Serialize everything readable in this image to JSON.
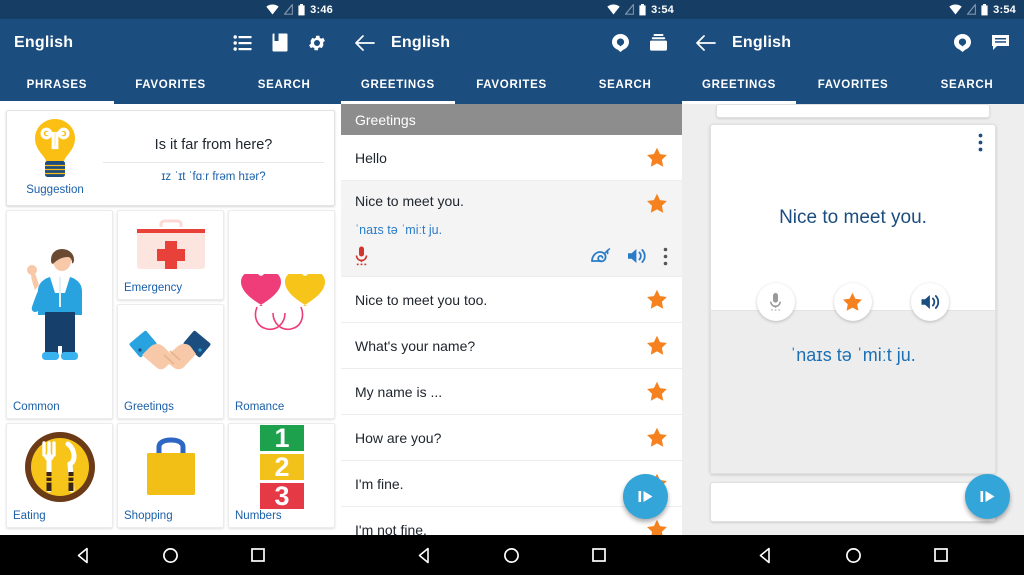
{
  "statusbar": {
    "time_left": "3:46",
    "time_mid": "3:54",
    "time_right": "3:54",
    "wifi_icon": "wifi-icon",
    "signal_icon": "signal-off-icon",
    "battery_icon": "battery-icon"
  },
  "panel1": {
    "title": "English",
    "actions": [
      {
        "name": "phrasebook-list-icon",
        "label": "list"
      },
      {
        "name": "flashcards-icon",
        "label": "flashcards"
      },
      {
        "name": "gear-icon",
        "label": "settings"
      }
    ],
    "tabs": [
      {
        "label": "PHRASES",
        "active": true
      },
      {
        "label": "FAVORITES",
        "active": false
      },
      {
        "label": "SEARCH",
        "active": false
      }
    ],
    "suggestion": {
      "caption": "Suggestion",
      "phrase": "Is it far from here?",
      "ipa": "ɪz ˈɪt ˈfɑːr frəm hɪər?"
    },
    "tiles": [
      {
        "label": "Common",
        "icon": "person-pointing-icon"
      },
      {
        "label": "Emergency",
        "icon": "first-aid-kit-icon"
      },
      {
        "label": "Romance",
        "icon": "two-hearts-icon"
      },
      {
        "label": "Greetings",
        "icon": "handshake-icon"
      },
      {
        "label": "Eating",
        "icon": "fork-knife-plate-icon"
      },
      {
        "label": "Shopping",
        "icon": "shopping-bag-icon"
      },
      {
        "label": "Numbers",
        "icon": "numbers-123-icon"
      }
    ]
  },
  "panel2": {
    "title": "English",
    "back_icon": "back-arrow-icon",
    "actions": [
      {
        "name": "quiz-balloon-icon",
        "label": "quiz"
      },
      {
        "name": "stacked-cards-icon",
        "label": "cards"
      }
    ],
    "tabs": [
      {
        "label": "GREETINGS",
        "active": true
      },
      {
        "label": "FAVORITES",
        "active": false
      },
      {
        "label": "SEARCH",
        "active": false
      }
    ],
    "section_header": "Greetings",
    "phrases": [
      {
        "text": "Hello",
        "favorite": true,
        "expanded": false
      },
      {
        "text": "Nice to meet you.",
        "ipa": "ˈnaɪs tə ˈmiːt ju.",
        "favorite": true,
        "expanded": true,
        "row_actions": [
          "mic-record-icon",
          "snail-slow-speech-icon",
          "speaker-icon",
          "overflow-menu-icon"
        ]
      },
      {
        "text": "Nice to meet you too.",
        "favorite": true,
        "expanded": false
      },
      {
        "text": "What's your name?",
        "favorite": true,
        "expanded": false
      },
      {
        "text": "My name is ...",
        "favorite": true,
        "expanded": false
      },
      {
        "text": "How are you?",
        "favorite": true,
        "expanded": false
      },
      {
        "text": "I'm fine.",
        "favorite": true,
        "expanded": false
      },
      {
        "text": "I'm not fine.",
        "favorite": true,
        "expanded": false
      }
    ],
    "fab": {
      "name": "play-all-fab",
      "icon": "play-icon"
    }
  },
  "panel3": {
    "title": "English",
    "back_icon": "back-arrow-icon",
    "actions": [
      {
        "name": "quiz-balloon-icon",
        "label": "quiz"
      },
      {
        "name": "chat-bubble-icon",
        "label": "conversation"
      }
    ],
    "tabs": [
      {
        "label": "GREETINGS",
        "active": true
      },
      {
        "label": "FAVORITES",
        "active": false
      },
      {
        "label": "SEARCH",
        "active": false
      }
    ],
    "card": {
      "menu_icon": "overflow-menu-icon",
      "front": "Nice to meet you.",
      "back_ipa": "ˈnaɪs tə ˈmiːt ju.",
      "buttons": [
        {
          "name": "mic-record-button",
          "icon": "mic-icon"
        },
        {
          "name": "favorite-button",
          "icon": "star-icon"
        },
        {
          "name": "speak-button",
          "icon": "speaker-icon"
        }
      ]
    },
    "fab": {
      "name": "play-all-fab",
      "icon": "play-icon"
    }
  },
  "navbar": [
    {
      "name": "nav-back-button",
      "icon": "triangle-back-icon"
    },
    {
      "name": "nav-home-button",
      "icon": "circle-home-icon"
    },
    {
      "name": "nav-recents-button",
      "icon": "square-recents-icon"
    }
  ],
  "colors": {
    "appbar": "#1b4d7e",
    "statusbar": "#163d63",
    "accent_star": "#f5821f",
    "link_blue": "#1b60a8",
    "fab": "#34a5d8",
    "section_gray": "#8d8d8d"
  }
}
